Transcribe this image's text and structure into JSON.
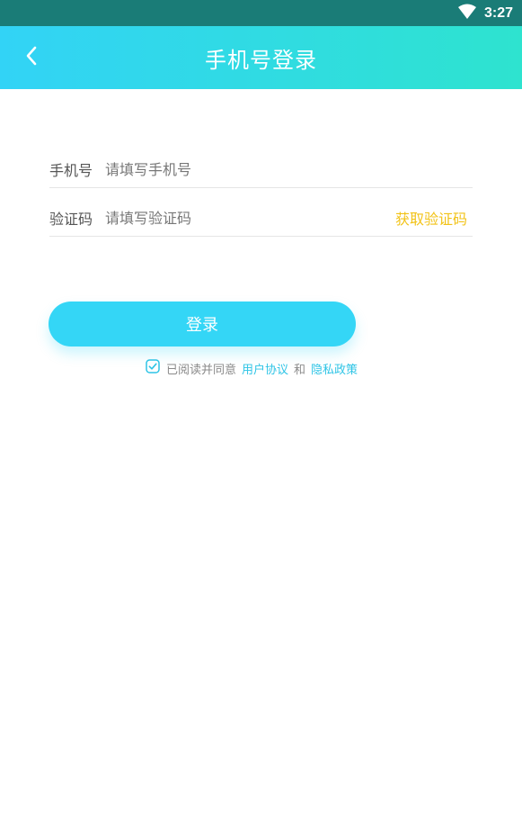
{
  "status_bar": {
    "time": "3:27",
    "wifi_icon": "wifi-icon"
  },
  "header": {
    "title": "手机号登录",
    "back_icon": "chevron-left-icon"
  },
  "form": {
    "phone": {
      "label": "手机号",
      "placeholder": "请填写手机号",
      "value": ""
    },
    "code": {
      "label": "验证码",
      "placeholder": "请填写验证码",
      "value": "",
      "get_code_label": "获取验证码"
    }
  },
  "login_button": {
    "label": "登录"
  },
  "agreement": {
    "checked": true,
    "prefix": "已阅读并同意",
    "user_agreement": "用户协议",
    "and": "和",
    "privacy_policy": "隐私政策"
  },
  "colors": {
    "status_bar": "#1a7c77",
    "header_gradient_start": "#32d3f6",
    "header_gradient_end": "#2ee3cf",
    "accent": "#34d6f6",
    "get_code": "#f2c318",
    "link": "#2ec4e6"
  }
}
